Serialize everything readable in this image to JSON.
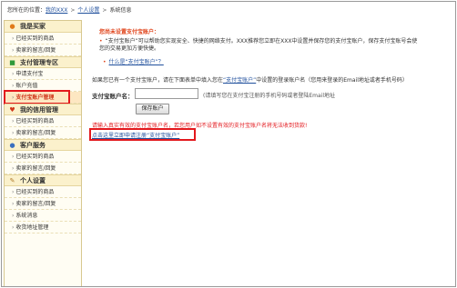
{
  "breadcrumb": {
    "prefix": "您所在的位置：",
    "home": "我的XXX",
    "personal": "个人设置",
    "current": "系统信息",
    "separator": ">"
  },
  "sidebar": {
    "sections": [
      {
        "title": "我是买家",
        "icon": "buyer-icon",
        "items": [
          "已经买到的商品",
          "卖家的留言/回复"
        ]
      },
      {
        "title": "支付管理专区",
        "icon": "payment-icon",
        "items": [
          "申请支付宝",
          "账户充值",
          "支付宝账户管理"
        ],
        "active": "支付宝账户管理"
      },
      {
        "title": "我的信用管理",
        "icon": "credit-icon",
        "items": [
          "已经买到的商品",
          "卖家的留言/回复"
        ]
      },
      {
        "title": "客户服务",
        "icon": "service-icon",
        "items": [
          "已经买到的商品",
          "卖家的留言/回复"
        ]
      },
      {
        "title": "个人设置",
        "icon": "settings-icon",
        "items": [
          "已经买到的商品",
          "卖家的留言/回复",
          "系统消息",
          "收货地址管理"
        ]
      }
    ]
  },
  "main": {
    "notice_title": "您尚未设置支付宝账户：",
    "notice_body": "“支付宝账户”可以帮助您实现安全、快捷的网络支付。XXX推荐您立即在XXX中设置并保存您的支付宝账户，保存支付宝账号会使您的交易更加方便快捷。",
    "notice_link": "什么是“支付宝账户”？",
    "instruction_before": "如果您已有一个支付宝账户，请在下面表单中填入您在",
    "instruction_link": "“支付宝账户”",
    "instruction_after": "中设置的登录账户名（您用来登录的Email地址或者手机号码）",
    "field_label": "支付宝账户名：",
    "field_value": "",
    "field_hint": "(请填写您在支付宝注册的手机号码或者登陆Email地址",
    "save_button": "保存账户",
    "warning": "请输入真实有效的支付宝账户名，若您用户如不设置有效的支付宝账户名将无法收到货款!",
    "register_link": "点击这里立即申请注册“支付宝账户”"
  },
  "colors": {
    "highlight": "#e3181d",
    "link": "#1f4f9c",
    "notice": "#e0451c",
    "sidebar_head": "#fbf1cc"
  }
}
